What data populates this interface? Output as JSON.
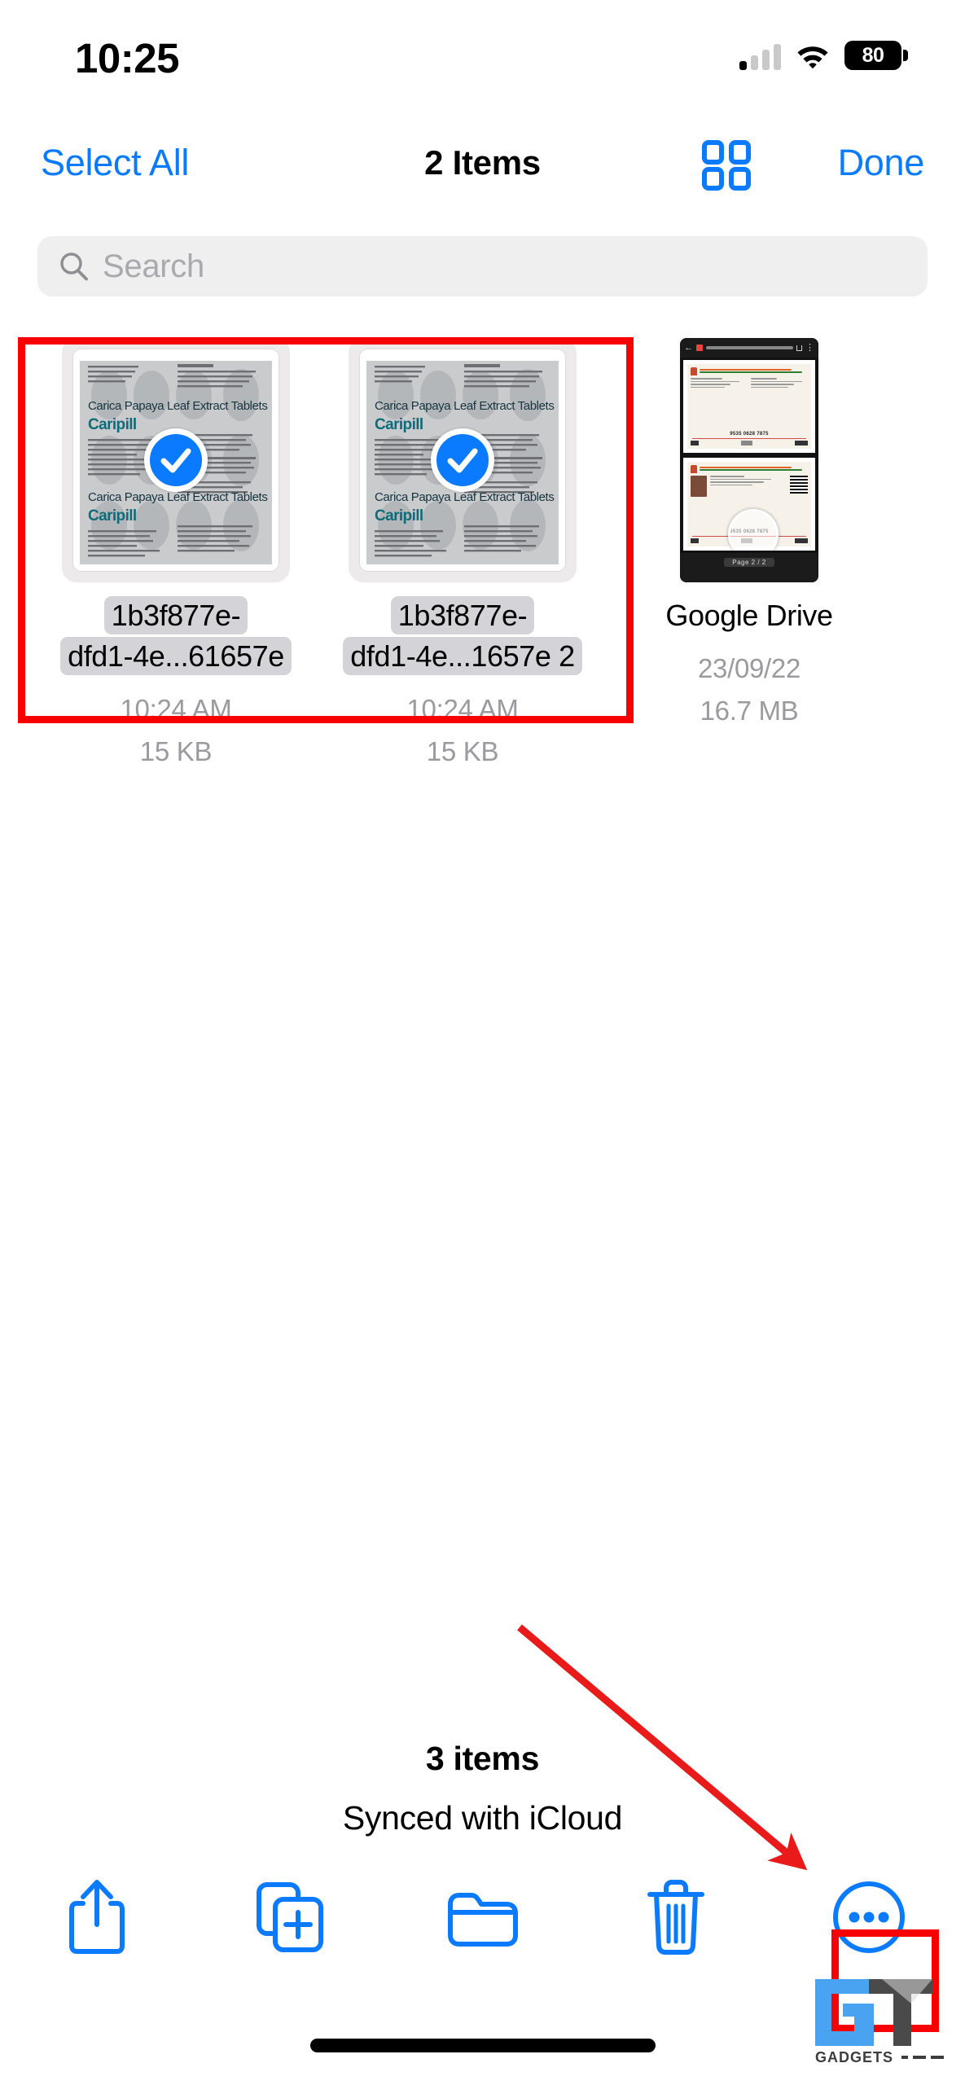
{
  "status_bar": {
    "time": "10:25",
    "battery_percent": "80",
    "cellular_icon": "cellular-signal-icon",
    "wifi_icon": "wifi-icon",
    "battery_icon": "battery-icon"
  },
  "nav_bar": {
    "select_all_label": "Select All",
    "title": "2 Items",
    "grid_view_icon": "grid-view-icon",
    "done_label": "Done"
  },
  "search": {
    "placeholder": "Search",
    "icon": "search-icon",
    "value": ""
  },
  "files": [
    {
      "name_line1": "1b3f877e-",
      "name_line2": "dfd1-4e...61657e",
      "date": "10:24 AM",
      "size": "15 KB",
      "selected": true,
      "thumbnail": "medicine-blister-pack-document",
      "thumb_text_line1": "Carica Papaya Leaf Extract Tablets",
      "thumb_text_line2": "Caripill"
    },
    {
      "name_line1": "1b3f877e-",
      "name_line2": "dfd1-4e...1657e 2",
      "date": "10:24 AM",
      "size": "15 KB",
      "selected": true,
      "thumbnail": "medicine-blister-pack-document",
      "thumb_text_line1": "Carica Papaya Leaf Extract Tablets",
      "thumb_text_line2": "Caripill"
    },
    {
      "name_line1": "Google Drive",
      "name_line2": "",
      "date": "23/09/22",
      "size": "16.7 MB",
      "selected": false,
      "thumbnail": "phone-screenshot-id-document",
      "thumb_text_line1": "",
      "thumb_text_line2": ""
    }
  ],
  "footer": {
    "item_count": "3 items",
    "sync_status": "Synced with iCloud"
  },
  "toolbar": [
    {
      "name": "share-button",
      "icon": "share-icon"
    },
    {
      "name": "duplicate-button",
      "icon": "duplicate-icon"
    },
    {
      "name": "move-to-folder-button",
      "icon": "folder-icon"
    },
    {
      "name": "delete-button",
      "icon": "trash-icon"
    },
    {
      "name": "more-button",
      "icon": "ellipsis-circle-icon"
    }
  ],
  "colors": {
    "accent_blue": "#0a7bff",
    "annotation_red": "#f70000",
    "selected_label_gray": "#d3d3d8",
    "search_bg": "#efeff0",
    "meta_gray": "#9a9a9f"
  },
  "watermark": {
    "brand": "GADGETS",
    "logo": "gt-logo"
  }
}
